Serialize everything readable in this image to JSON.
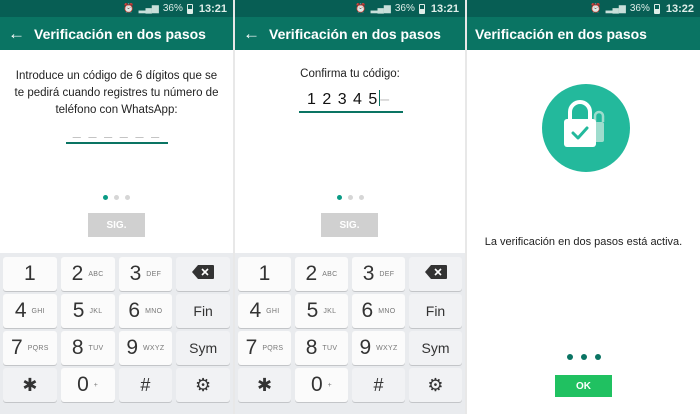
{
  "status": {
    "signal": "36%",
    "times": [
      "13:21",
      "13:21",
      "13:22"
    ]
  },
  "colors": {
    "header": "#0a7463",
    "status_bar": "#075e54",
    "accent": "#0a9b85",
    "lock_bg": "#23b99c",
    "ok_button": "#20c161"
  },
  "screen1": {
    "title": "Verificación en dos pasos",
    "instruction": "Introduce un código de 6 dígitos que se te pedirá cuando registres tu número de teléfono con WhatsApp:",
    "code_placeholder": "_ _ _   _ _ _",
    "next_button": "SIG."
  },
  "screen2": {
    "title": "Verificación en dos pasos",
    "confirm_label": "Confirma tu código:",
    "code_entered": "1 2 3   4 5",
    "code_remaining": "–",
    "next_button": "SIG."
  },
  "screen3": {
    "title": "Verificación en dos pasos",
    "message": "La verificación en dos pasos está activa.",
    "ok_button": "OK",
    "icon": "padlock-check-icon"
  },
  "keyboard": {
    "keys": [
      {
        "main": "1",
        "sub": ""
      },
      {
        "main": "2",
        "sub": "ABC"
      },
      {
        "main": "3",
        "sub": "DEF"
      },
      {
        "main": "⌫",
        "sub": "",
        "kind": "backspace"
      },
      {
        "main": "4",
        "sub": "GHI"
      },
      {
        "main": "5",
        "sub": "JKL"
      },
      {
        "main": "6",
        "sub": "MNO"
      },
      {
        "main": "Fin",
        "sub": "",
        "kind": "word"
      },
      {
        "main": "7",
        "sub": "PQRS"
      },
      {
        "main": "8",
        "sub": "TUV"
      },
      {
        "main": "9",
        "sub": "WXYZ"
      },
      {
        "main": "Sym",
        "sub": "",
        "kind": "word"
      },
      {
        "main": "✱",
        "sub": "",
        "kind": "glyph"
      },
      {
        "main": "0",
        "sub": "+"
      },
      {
        "main": "#",
        "sub": "",
        "kind": "glyph"
      },
      {
        "main": "⚙",
        "sub": "",
        "kind": "glyph"
      }
    ]
  }
}
